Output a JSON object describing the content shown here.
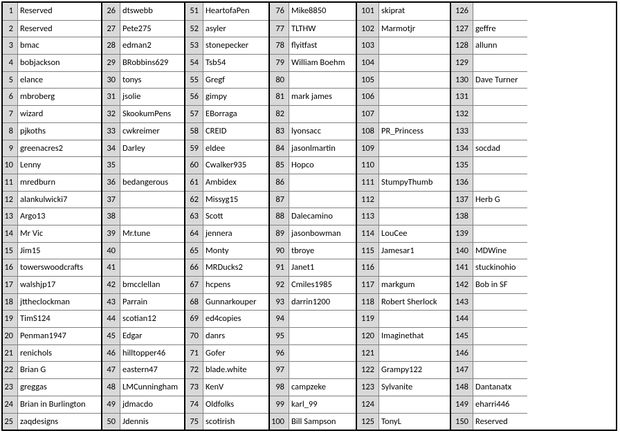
{
  "chart_data": {
    "type": "table",
    "columns": [
      {
        "start": 1,
        "end": 25,
        "entries": [
          "Reserved",
          "Reserved",
          "bmac",
          "bobjackson",
          "elance",
          "mbroberg",
          "wizard",
          "pjkoths",
          "greenacres2",
          "Lenny",
          "mredburn",
          "alankulwicki7",
          "Argo13",
          "Mr Vic",
          "Jim15",
          "towerswoodcrafts",
          "walshjp17",
          "jttheclockman",
          "TimS124",
          "Penman1947",
          "renichols",
          "Brian G",
          "greggas",
          "Brian in Burlington",
          "zaqdesigns"
        ]
      },
      {
        "start": 26,
        "end": 50,
        "entries": [
          "dtswebb",
          "Pete275",
          "edman2",
          "BRobbins629",
          "tonys",
          "jsolie",
          "SkookumPens",
          "cwkreimer",
          "Darley",
          "",
          "bedangerous",
          "",
          "",
          "Mr.tune",
          "",
          "",
          "bmcclellan",
          "Parrain",
          "scotian12",
          "Edgar",
          "hilltopper46",
          "eastern47",
          "LMCunningham",
          "jdmacdo",
          "Jdennis"
        ]
      },
      {
        "start": 51,
        "end": 75,
        "entries": [
          "HeartofaPen",
          "asyler",
          "stonepecker",
          "Tsb54",
          "Gregf",
          "gimpy",
          "EBorraga",
          "CREID",
          "eldee",
          "Cwalker935",
          "Ambidex",
          "Missyg15",
          "Scott",
          "jennera",
          "Monty",
          "MRDucks2",
          "hcpens",
          "Gunnarkouper",
          "ed4copies",
          "danrs",
          "Gofer",
          "blade.white",
          "KenV",
          "Oldfolks",
          "scotirish"
        ]
      },
      {
        "start": 76,
        "end": 100,
        "entries": [
          "Mike8850",
          "TLTHW",
          "flyitfast",
          "William Boehm",
          "",
          "mark james",
          "",
          "lyonsacc",
          "jasonlmartin",
          "Hopco",
          "",
          "",
          "Dalecamino",
          "jasonbowman",
          "tbroye",
          "Janet1",
          "Cmiles1985",
          "darrin1200",
          "",
          "",
          "",
          "",
          "campzeke",
          "karl_99",
          "Bill Sampson"
        ]
      },
      {
        "start": 101,
        "end": 125,
        "entries": [
          "skiprat",
          "Marmotjr",
          "",
          "",
          "",
          "",
          "",
          "PR_Princess",
          "",
          "",
          "StumpyThumb",
          "",
          "",
          "LouCee",
          "Jamesar1",
          "",
          "markgum",
          "Robert Sherlock",
          "",
          "Imaginethat",
          "",
          "Grampy122",
          "Sylvanite",
          "",
          "TonyL"
        ]
      },
      {
        "start": 126,
        "end": 150,
        "entries": [
          "",
          "geffre",
          "allunn",
          "",
          "Dave Turner",
          "",
          "",
          "",
          "socdad",
          "",
          "",
          "Herb G",
          "",
          "",
          "MDWine",
          "stuckinohio",
          "Bob in SF",
          "",
          "",
          "",
          "",
          "",
          "Dantanatx",
          "eharri446",
          "Reserved"
        ]
      }
    ]
  }
}
